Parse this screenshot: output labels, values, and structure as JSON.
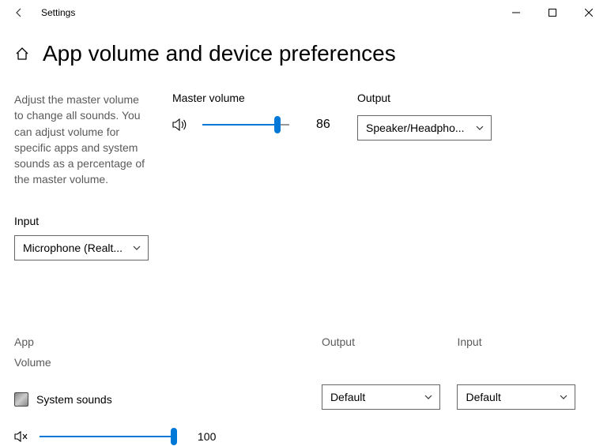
{
  "window": {
    "title": "Settings"
  },
  "page": {
    "title": "App volume and device preferences",
    "description": "Adjust the master volume to change all sounds. You can adjust volume for specific apps and system sounds as a percentage of the master volume."
  },
  "master": {
    "label": "Master volume",
    "value": 86,
    "percent": 86
  },
  "output": {
    "label": "Output",
    "selected": "Speaker/Headpho..."
  },
  "input": {
    "label": "Input",
    "selected": "Microphone (Realt..."
  },
  "columns": {
    "app": "App",
    "volume": "Volume",
    "output": "Output",
    "input": "Input"
  },
  "apps": [
    {
      "name": "System sounds",
      "volume": 100,
      "volume_percent": 100,
      "output": "Default",
      "input": "Default",
      "muted": true
    }
  ],
  "chart_data": {
    "type": "table",
    "title": "App volume and device preferences",
    "columns": [
      "App",
      "Volume",
      "Output",
      "Input"
    ],
    "rows": [
      [
        "System sounds",
        100,
        "Default",
        "Default"
      ]
    ],
    "master_volume": 86,
    "master_output": "Speaker/Headphone",
    "master_input": "Microphone (Realtek)"
  }
}
